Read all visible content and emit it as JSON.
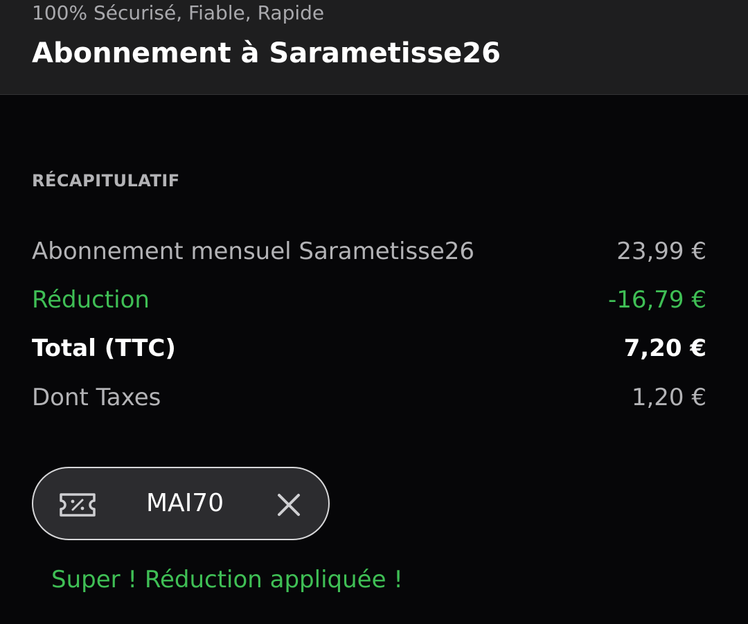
{
  "header": {
    "subtitle": "100% Sécurisé, Fiable, Rapide",
    "title": "Abonnement à Sarametisse26"
  },
  "summary": {
    "section_title": "RÉCAPITULATIF",
    "rows": [
      {
        "label": "Abonnement mensuel Sarametisse26",
        "value": "23,99 €"
      },
      {
        "label": "Réduction",
        "value": "-16,79 €"
      },
      {
        "label": "Total (TTC)",
        "value": "7,20 €"
      },
      {
        "label": "Dont Taxes",
        "value": "1,20 €"
      }
    ]
  },
  "coupon": {
    "icon": "discount-ticket-icon",
    "code": "MAI70",
    "remove_icon": "close-icon"
  },
  "success_message": "Super ! Réduction appliquée !",
  "colors": {
    "background": "#060608",
    "header_background": "#1e1e1f",
    "accent_green": "#3fbf55",
    "text_primary": "#ffffff",
    "text_secondary": "#b3b3b6"
  }
}
